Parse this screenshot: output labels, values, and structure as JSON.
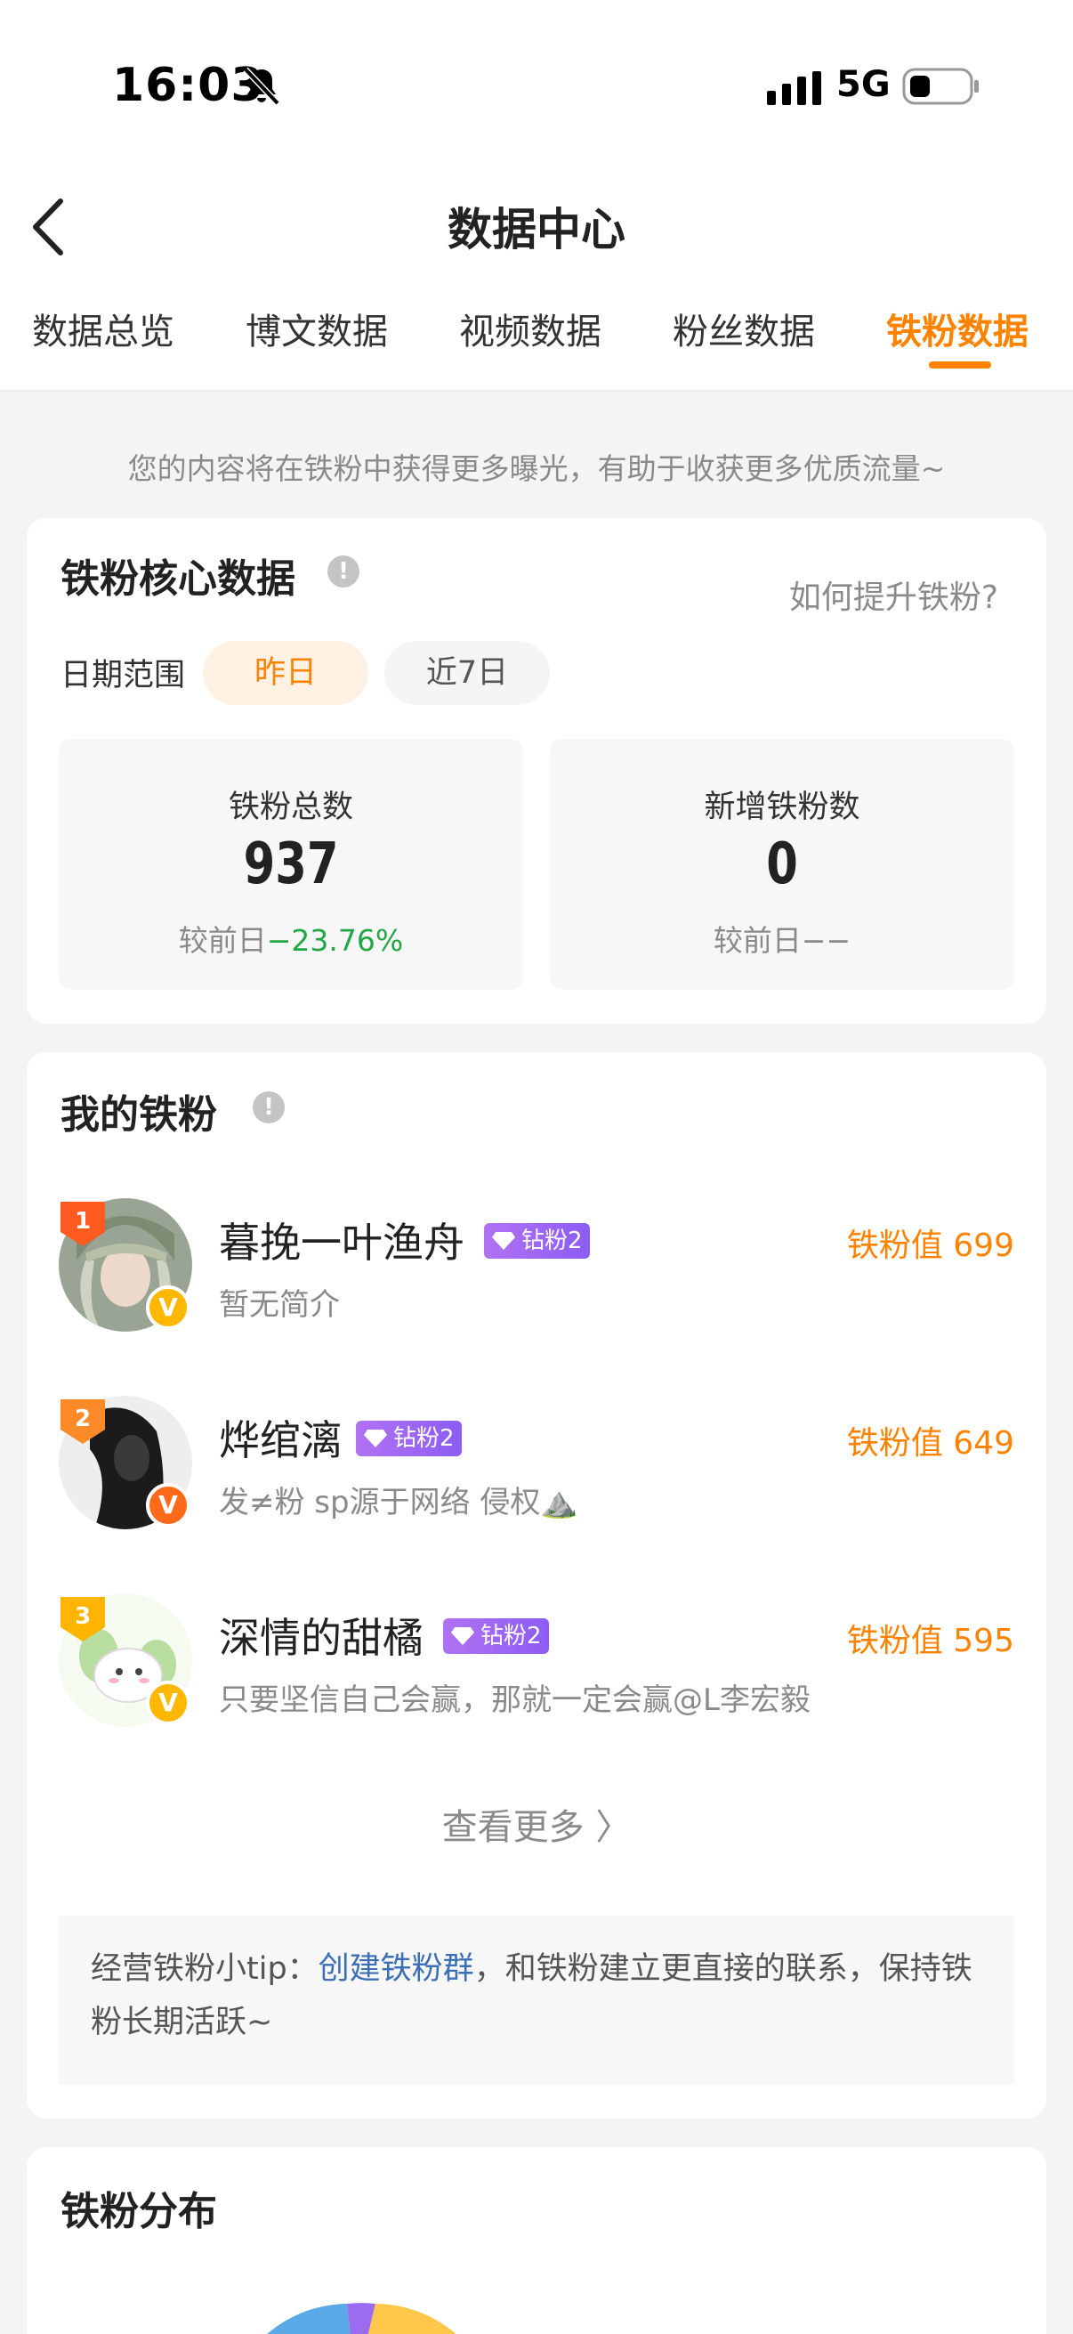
{
  "status_bar": {
    "time": "16:03",
    "network": "5G"
  },
  "header": {
    "title": "数据中心",
    "tabs": [
      {
        "label": "数据总览",
        "active": false
      },
      {
        "label": "博文数据",
        "active": false
      },
      {
        "label": "视频数据",
        "active": false
      },
      {
        "label": "粉丝数据",
        "active": false
      },
      {
        "label": "铁粉数据",
        "active": true
      }
    ]
  },
  "notice": "您的内容将在铁粉中获得更多曝光，有助于收获更多优质流量~",
  "core": {
    "title": "铁粉核心数据",
    "info_icon": "!",
    "help_link": "如何提升铁粉?",
    "date_label": "日期范围",
    "date_options": [
      "昨日",
      "近7日"
    ],
    "stats": [
      {
        "label": "铁粉总数",
        "value": "937",
        "compare_prefix": "较前日",
        "compare_value": "−23.76%"
      },
      {
        "label": "新增铁粉数",
        "value": "0",
        "compare_prefix": "较前日",
        "compare_value": "−−"
      }
    ]
  },
  "my_fans": {
    "title": "我的铁粉",
    "info_icon": "!",
    "fans": [
      {
        "rank": "1",
        "name": "暮挽一叶渔舟",
        "badge": "钻粉2",
        "bio": "暂无简介",
        "score": "铁粉值 699",
        "v": "V"
      },
      {
        "rank": "2",
        "name": "烨绾漓",
        "badge": "钻粉2",
        "bio": "发≠粉 sp源于网络 侵权⛰️",
        "score": "铁粉值 649",
        "v": "V"
      },
      {
        "rank": "3",
        "name": "深情的甜橘",
        "badge": "钻粉2",
        "bio": "只要坚信自己会赢，那就一定会赢@L李宏毅",
        "score": "铁粉值 595",
        "v": "V"
      }
    ],
    "see_more": "查看更多 〉",
    "tip_prefix": "经营铁粉小tip：",
    "tip_link": "创建铁粉群",
    "tip_suffix": "，和铁粉建立更直接的联系，保持铁粉长期活跃~"
  },
  "distribution": {
    "title": "铁粉分布"
  },
  "colors": {
    "accent": "#ff8200",
    "green": "#21a845",
    "link": "#3b6fb6"
  }
}
